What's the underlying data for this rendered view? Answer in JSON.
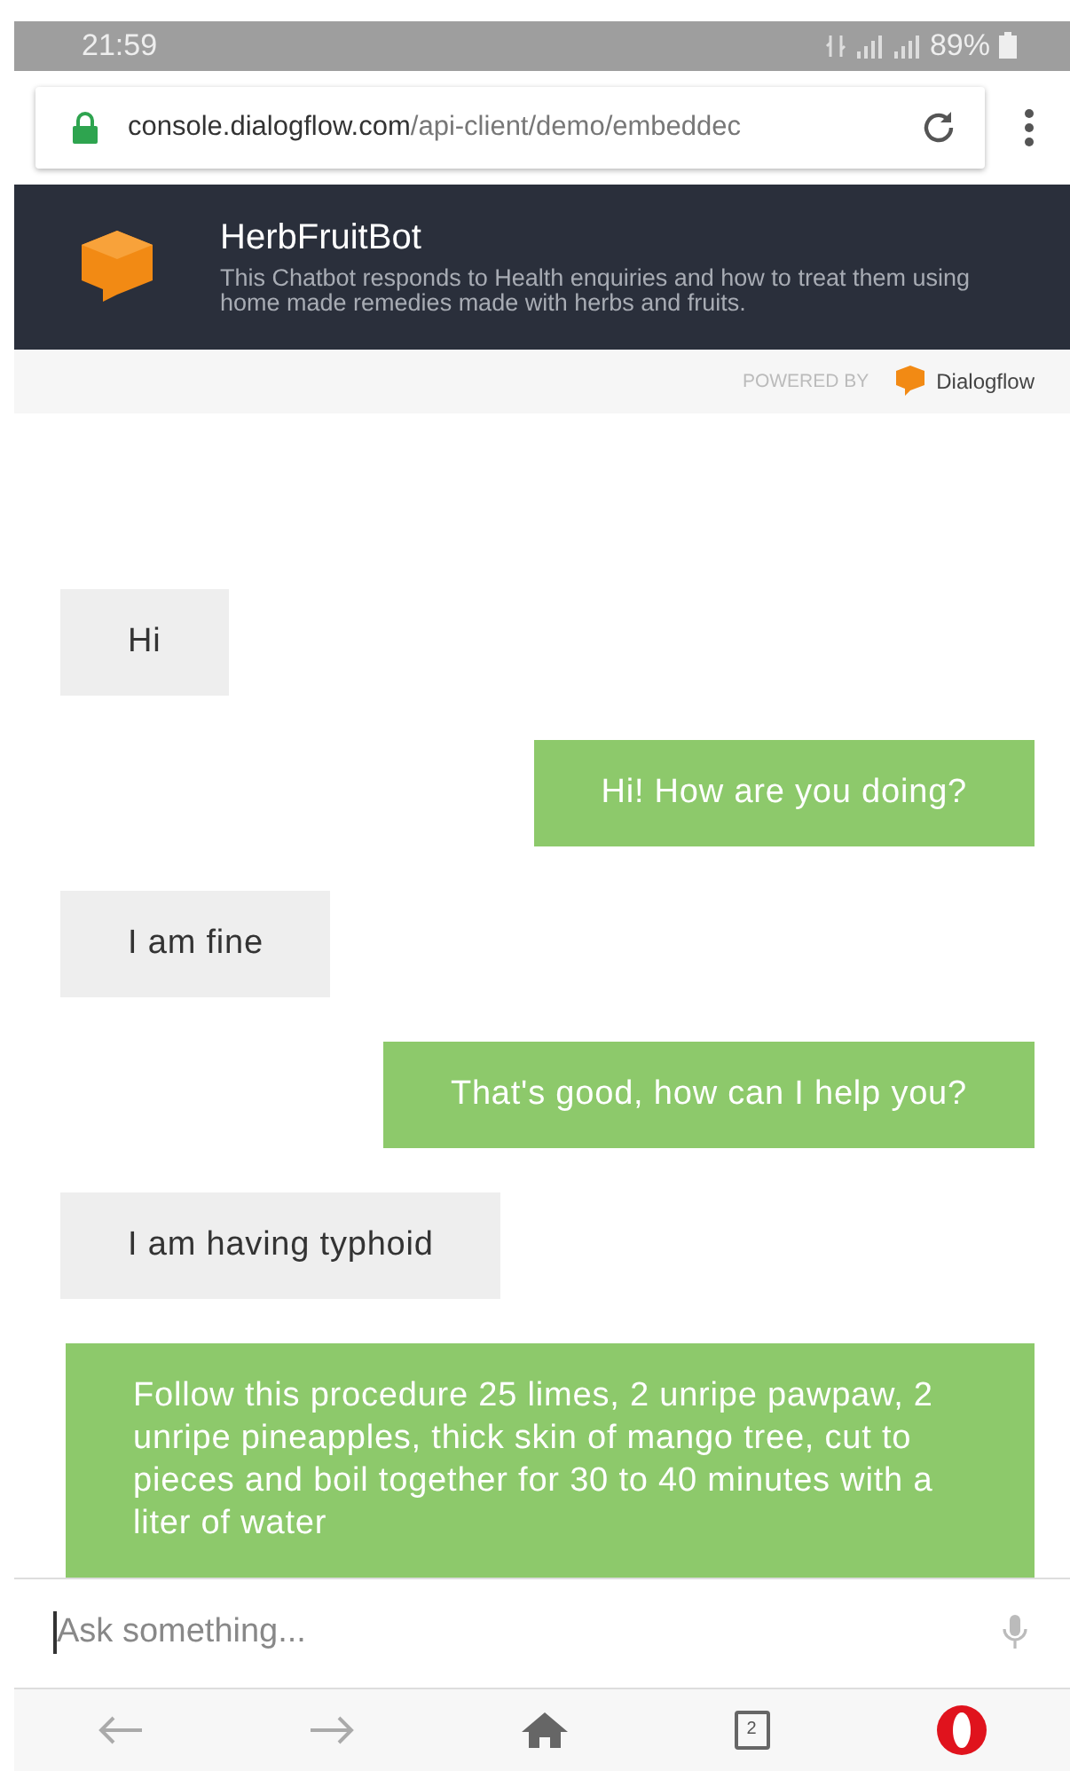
{
  "status_bar": {
    "time": "21:59",
    "battery": "89%"
  },
  "browser": {
    "url_host": "console.dialogflow.com",
    "url_path": "/api-client/demo/embeddec"
  },
  "bot": {
    "name": "HerbFruitBot",
    "description": "This Chatbot responds to Health enquiries and how to treat them using home made remedies made with herbs and fruits.",
    "powered_by": "POWERED BY",
    "brand": "Dialogflow"
  },
  "messages": [
    {
      "kind": "user",
      "text": "Hi"
    },
    {
      "kind": "bot",
      "text": "Hi! How are you doing?"
    },
    {
      "kind": "user",
      "text": "I am fine"
    },
    {
      "kind": "bot",
      "text": "That's good, how can I help you?"
    },
    {
      "kind": "user",
      "text": "I am having typhoid"
    },
    {
      "kind": "bot",
      "text": "Follow this procedure 25 limes, 2 unripe pawpaw, 2 unripe pineapples, thick skin of mango tree, cut to pieces and boil together for 30 to 40 minutes with a liter of water"
    }
  ],
  "input": {
    "placeholder": "Ask something..."
  },
  "nav": {
    "tab_count": "2"
  }
}
